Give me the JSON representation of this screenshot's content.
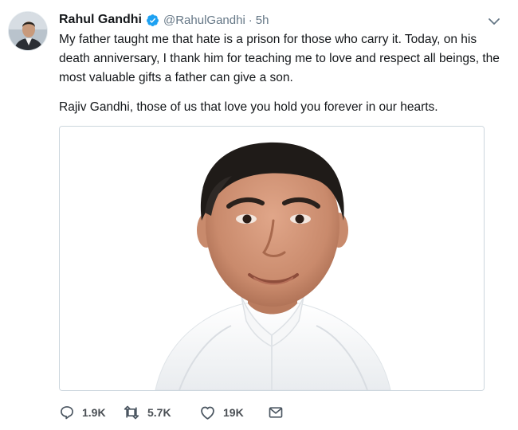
{
  "tweet": {
    "author_name": "Rahul Gandhi",
    "handle": "@RahulGandhi",
    "separator": "·",
    "time": "5h",
    "paragraphs": [
      "My father taught me that hate is a prison for those who carry it. Today, on his death anniversary, I thank him for teaching me to love and respect all beings, the most valuable gifts a father can give a son.",
      "Rajiv Gandhi, those of us that love you hold you forever in our hearts."
    ],
    "verified_badge_color": "#1da1f2"
  },
  "actions": {
    "replies": "1.9K",
    "retweets": "5.7K",
    "likes": "19K"
  },
  "icons": [
    "chevron-down-icon",
    "verified-badge-icon",
    "reply-icon",
    "retweet-icon",
    "like-icon",
    "direct-message-icon"
  ]
}
